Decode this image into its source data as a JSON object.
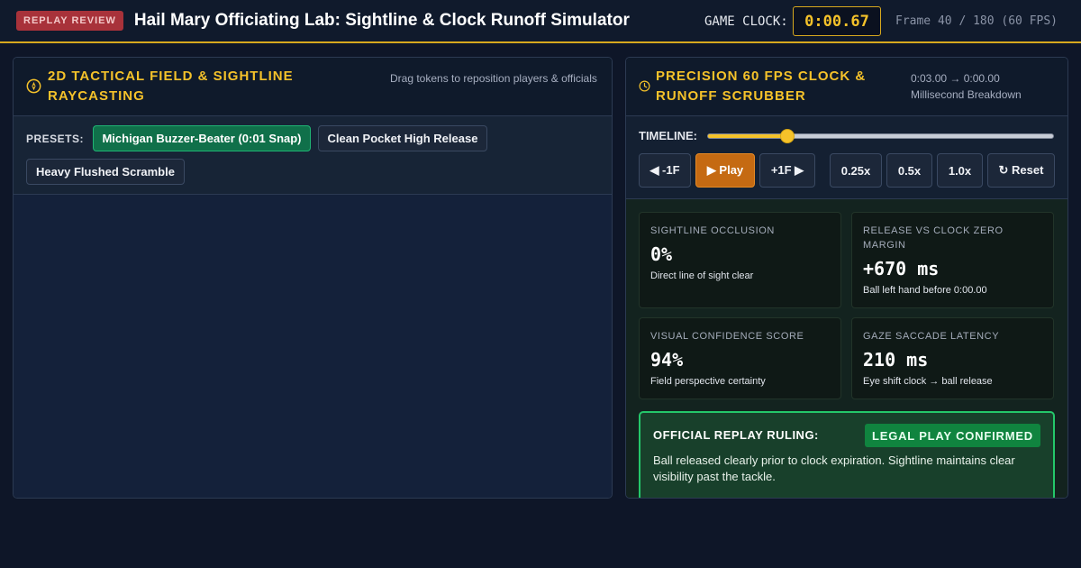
{
  "header": {
    "badge": "REPLAY REVIEW",
    "title": "Hail Mary Officiating Lab: Sightline & Clock Runoff Simulator",
    "clock_label": "GAME CLOCK:",
    "clock_value": "0:00.67",
    "frame_info": "Frame 40 / 180 (60 FPS)"
  },
  "left_panel": {
    "title": "2D Tactical Field & Sightline Raycasting",
    "icon": "compass-icon",
    "subtitle": "Drag tokens to reposition players & officials",
    "presets_label": "PRESETS:",
    "presets": [
      {
        "label": "Michigan Buzzer-Beater (0:01 Snap)",
        "active": true
      },
      {
        "label": "Clean Pocket High Release",
        "active": false
      },
      {
        "label": "Heavy Flushed Scramble",
        "active": false
      }
    ]
  },
  "right_panel": {
    "title": "Precision 60 FPS Clock & Runoff Scrubber",
    "icon": "clock-icon",
    "subtitle_line1": "0:03.00 → 0:00.00",
    "subtitle_line2": "Millisecond Breakdown",
    "timeline_label": "TIMELINE:",
    "timeline_progress": 0.23,
    "buttons": {
      "step_back": "◀ -1F",
      "play": "▶ Play",
      "step_forward": "+1F ▶",
      "speed_025": "0.25x",
      "speed_05": "0.5x",
      "speed_1": "1.0x",
      "reset": "↻ Reset"
    },
    "metrics": [
      {
        "label": "Sightline Occlusion",
        "value": "0%",
        "desc": "Direct line of sight clear"
      },
      {
        "label": "Release vs Clock Zero Margin",
        "value": "+670 ms",
        "desc": "Ball left hand before 0:00.00"
      },
      {
        "label": "Visual Confidence Score",
        "value": "94%",
        "desc": "Field perspective certainty"
      },
      {
        "label": "Gaze Saccade Latency",
        "value": "210 ms",
        "desc": "Eye shift clock → ball release"
      }
    ],
    "ruling": {
      "label": "OFFICIAL REPLAY RULING:",
      "verdict": "LEGAL PLAY CONFIRMED",
      "text": "Ball released clearly prior to clock expiration. Sightline maintains clear visibility past the tackle."
    }
  },
  "colors": {
    "accent": "#f5c22a",
    "badge_red": "#a8323a",
    "success": "#24c76a",
    "play": "#c56a12"
  }
}
